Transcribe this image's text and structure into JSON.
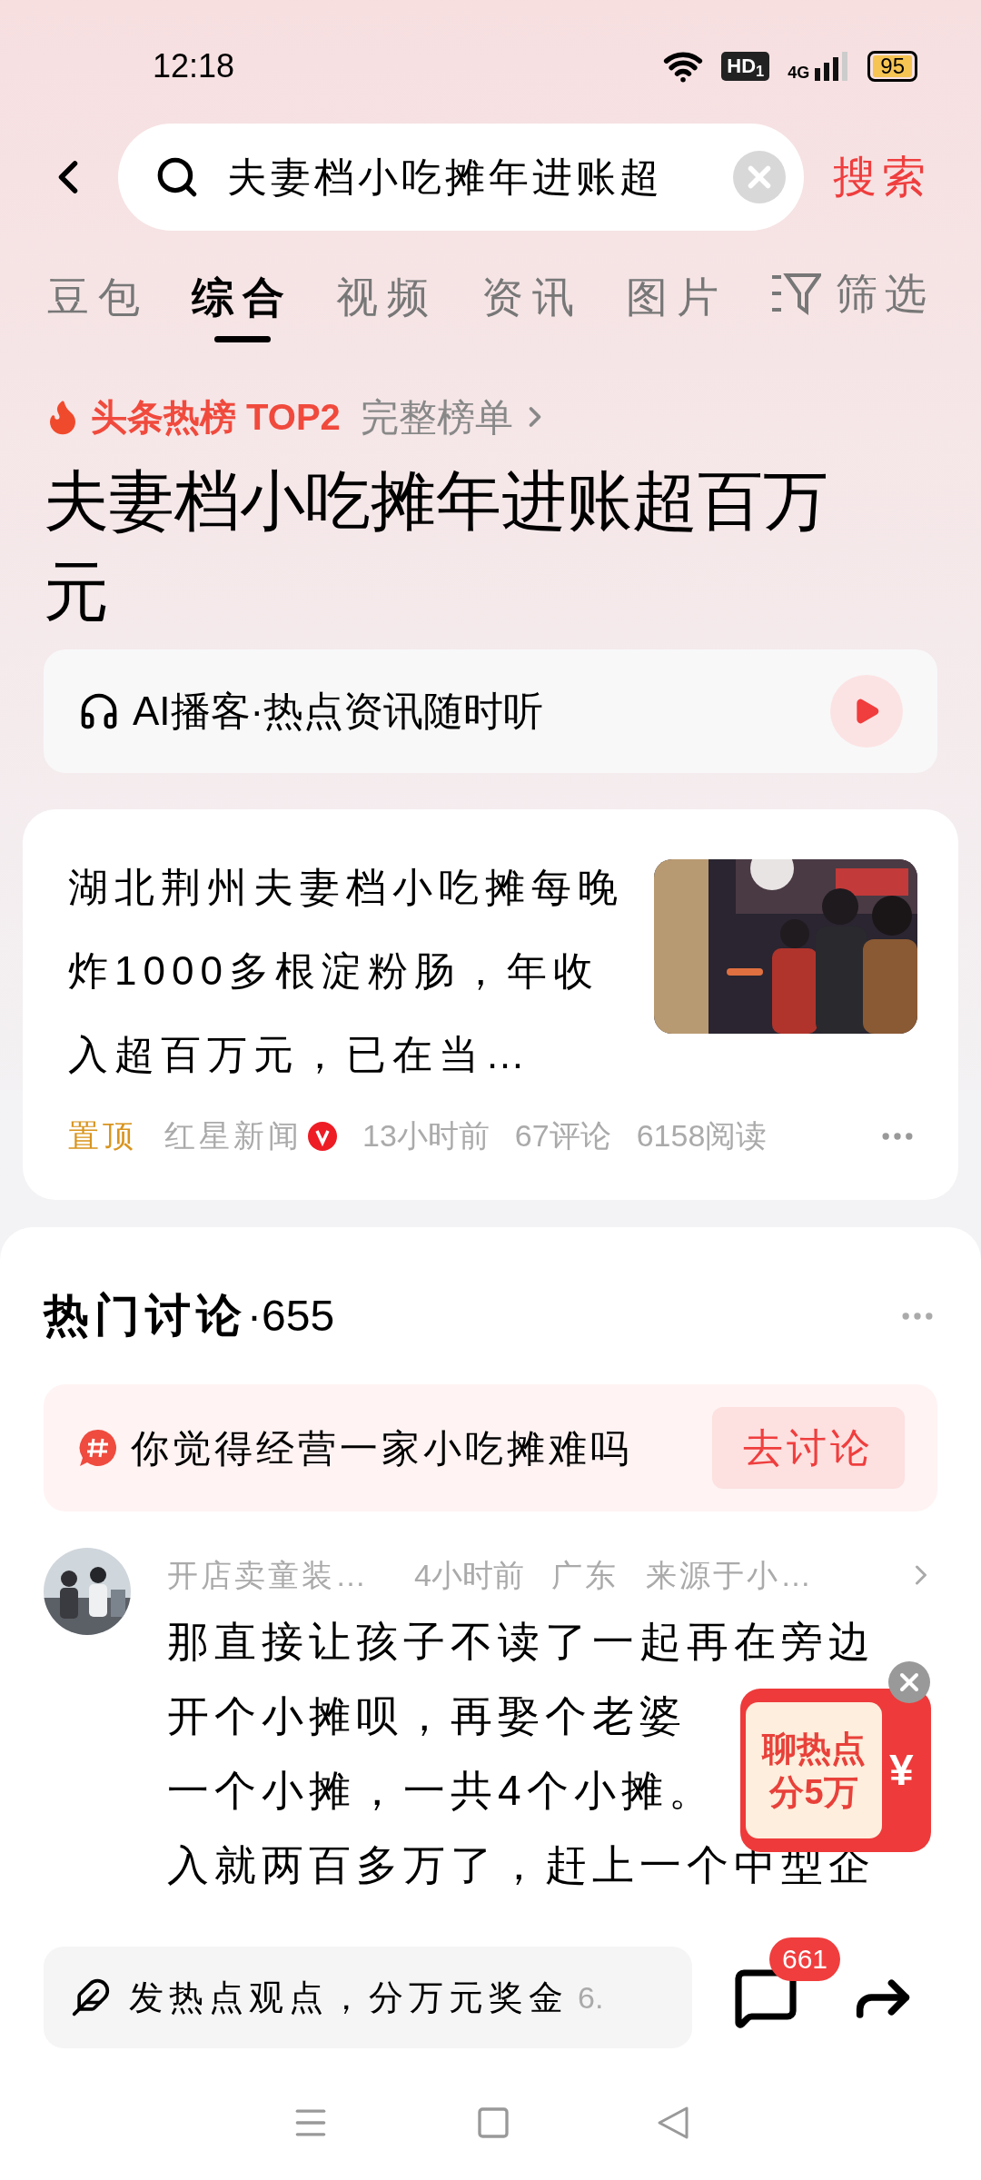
{
  "status_bar": {
    "time": "12:18",
    "hd_label": "HD$_{1}$",
    "network_label": "4G",
    "battery": "95"
  },
  "search": {
    "value": "夫妻档小吃摊年进账超",
    "button": "搜索"
  },
  "tabs": [
    {
      "label": "豆包",
      "selected": false
    },
    {
      "label": "综合",
      "selected": true
    },
    {
      "label": "视频",
      "selected": false
    },
    {
      "label": "资讯",
      "selected": false
    },
    {
      "label": "图片",
      "selected": false
    }
  ],
  "filter_button": "筛选",
  "hot": {
    "badge": "头条热榜 TOP2",
    "link": "完整榜单"
  },
  "headline": "夫妻档小吃摊年进账超百万元",
  "podcast": {
    "label": "AI播客·热点资讯随时听"
  },
  "article": {
    "title": "湖北荆州夫妻档小吃摊每晚炸1000多根淀粉肠，年收入超百万元，已在当…",
    "pinned": "置顶",
    "source": "红星新闻",
    "verified": true,
    "time": "13小时前",
    "comments": "67评论",
    "reads": "6158阅读"
  },
  "discussion": {
    "title": "热门讨论",
    "count": "·655",
    "topic": "你觉得经营一家小吃摊难吗",
    "topic_button": "去讨论"
  },
  "comment": {
    "author": "开店卖童装…",
    "time": "4小时前",
    "location": "广东",
    "source": "来源于小…",
    "lines": [
      "那直接让孩子不读了一起再在旁边",
      "开个小摊呗，再娶个老婆",
      "一个小摊，一共4个小摊。",
      "入就两百多万了，赶上一个中型企"
    ]
  },
  "promo": {
    "lines": [
      "聊热点",
      "分5万"
    ],
    "symbol": "¥"
  },
  "bottom": {
    "prompt": "发热点观点，分万元奖金",
    "hint": "6.",
    "comment_count": "661"
  }
}
